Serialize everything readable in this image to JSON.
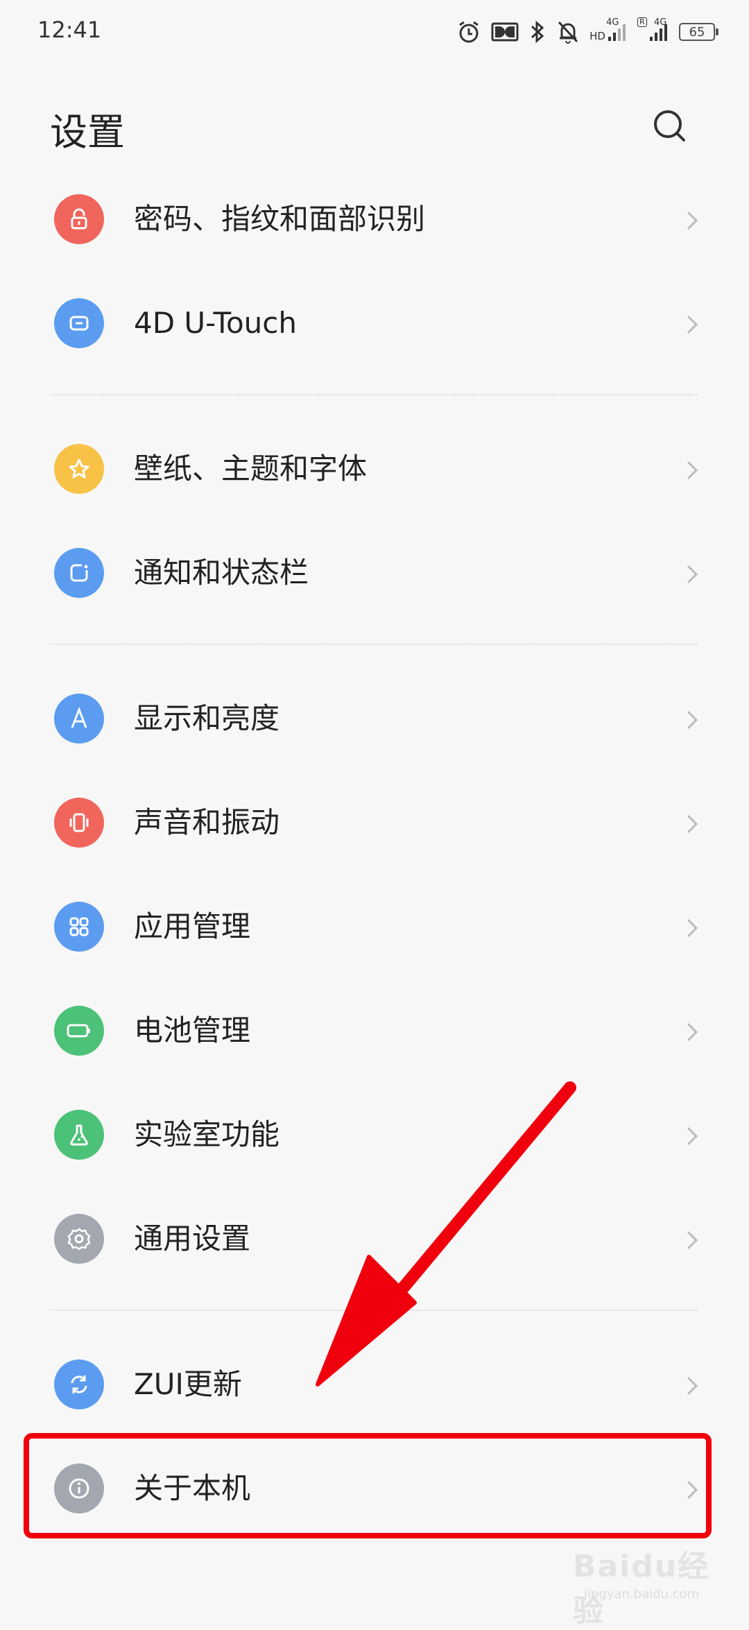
{
  "status_bar": {
    "time": "12:41",
    "net1_tag": "4G",
    "net1_sub": "HD",
    "net2_tag": "4G",
    "net2_r": "R",
    "battery": "65"
  },
  "header": {
    "title": "设置",
    "search_icon": "search-icon"
  },
  "items": [
    {
      "label": "密码、指纹和面部识别",
      "icon": "lock-icon",
      "color": "#f0655c"
    },
    {
      "label": "4D U-Touch",
      "icon": "touch-icon",
      "color": "#5b9cf0"
    },
    {
      "label": "壁纸、主题和字体",
      "icon": "star-icon",
      "color": "#f7c246"
    },
    {
      "label": "通知和状态栏",
      "icon": "notification-icon",
      "color": "#5b9cf0"
    },
    {
      "label": "显示和亮度",
      "icon": "display-icon",
      "color": "#5b9cf0"
    },
    {
      "label": "声音和振动",
      "icon": "vibrate-icon",
      "color": "#f0655c"
    },
    {
      "label": "应用管理",
      "icon": "apps-icon",
      "color": "#5b9cf0"
    },
    {
      "label": "电池管理",
      "icon": "battery-icon",
      "color": "#4cc178"
    },
    {
      "label": "实验室功能",
      "icon": "flask-icon",
      "color": "#4cc178"
    },
    {
      "label": "通用设置",
      "icon": "gear-icon",
      "color": "#a3a8b0"
    },
    {
      "label": "ZUI更新",
      "icon": "update-icon",
      "color": "#5b9cf0"
    },
    {
      "label": "关于本机",
      "icon": "info-icon",
      "color": "#a3a8b0"
    }
  ],
  "annotation": {
    "highlight_color": "#f0000c"
  },
  "watermark": {
    "brand": "Baidu经验",
    "site": "jingyan.baidu.com"
  }
}
